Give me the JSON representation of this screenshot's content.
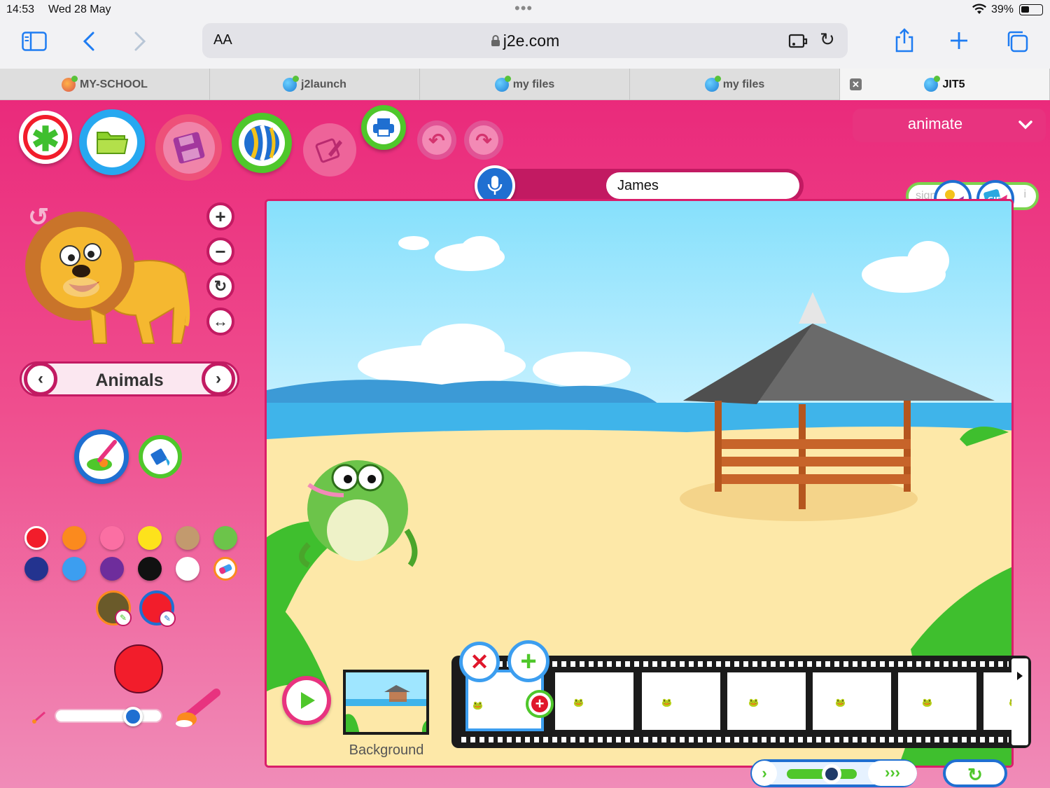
{
  "status": {
    "time": "14:53",
    "date": "Wed 28 May",
    "battery": "39%"
  },
  "browser": {
    "text_size_button": "AA",
    "url": "j2e.com",
    "tabs": [
      {
        "label": "MY-SCHOOL"
      },
      {
        "label": "j2launch"
      },
      {
        "label": "my files"
      },
      {
        "label": "my files"
      },
      {
        "label": "JIT5"
      }
    ]
  },
  "app": {
    "mode_dropdown": "animate",
    "author_name": "James",
    "category": "Animals",
    "background_label": "Background",
    "sign_label": "sign",
    "info_label": "i",
    "colors": {
      "row1": [
        "#f21d2b",
        "#fb8a1e",
        "#fb6fa3",
        "#fde21c",
        "#c29a6e",
        "#6cc44a"
      ],
      "row2": [
        "#23338f",
        "#3c9ef0",
        "#6e2d9c",
        "#111111",
        "#ffffff"
      ],
      "current": "#f21d2b"
    },
    "brush_size": 0.73,
    "timeline_speed": 0.64,
    "frame_count": 7
  }
}
